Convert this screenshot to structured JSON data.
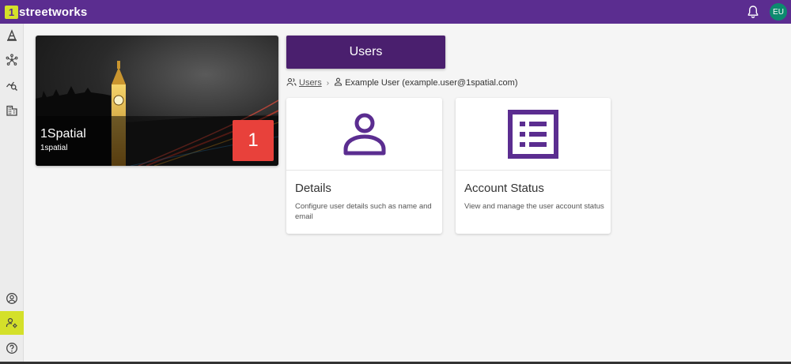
{
  "app": {
    "logo_mark": "1",
    "logo_text": "streetworks"
  },
  "header": {
    "bell_icon": "bell-icon",
    "avatar_initials": "EU",
    "avatar_color": "#0c8a6e"
  },
  "sidebar": {
    "items": [
      {
        "icon": "cone-icon"
      },
      {
        "icon": "network-icon"
      },
      {
        "icon": "analytics-search-icon"
      },
      {
        "icon": "building-icon"
      },
      {
        "icon": "account-circle-icon"
      },
      {
        "icon": "user-settings-icon",
        "active": true
      },
      {
        "icon": "help-icon"
      }
    ]
  },
  "organisation": {
    "name": "1Spatial",
    "sub": "1spatial",
    "badge": "1",
    "badge_color": "#e8413b"
  },
  "page": {
    "title": "Users"
  },
  "breadcrumb": {
    "users_link": "Users",
    "separator": "›",
    "current": "Example User (example.user@1spatial.com)"
  },
  "cards": [
    {
      "icon": "user-icon",
      "title": "Details",
      "description": "Configure user details such as name and email"
    },
    {
      "icon": "list-icon",
      "title": "Account Status",
      "description": "View and manage the user account status"
    }
  ],
  "colors": {
    "brand_purple": "#5b2d90",
    "accent_lime": "#d4e02a",
    "button_purple": "#4a1f6e",
    "icon_purple": "#5b2d90"
  }
}
